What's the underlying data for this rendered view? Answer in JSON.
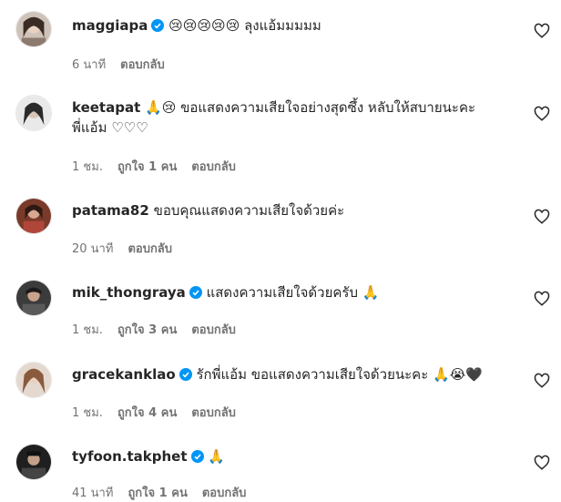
{
  "comments": [
    {
      "username": "maggiapa",
      "verified": true,
      "text": "😢😢😢😢😢 ลุงแอ้มมมมม",
      "time": "6 นาที",
      "likes": "",
      "reply": "ตอบกลับ"
    },
    {
      "username": "keetapat",
      "verified": false,
      "text": "🙏😢 ขอแสดงความเสียใจอย่างสุดซึ้ง หลับให้สบายนะคะ",
      "text2": "พี่แอ้ม ♡♡♡",
      "time": "1 ชม.",
      "likes": "ถูกใจ 1 คน",
      "reply": "ตอบกลับ"
    },
    {
      "username": "patama82",
      "verified": false,
      "text": "ขอบคุณแสดงความเสียใจด้วยค่ะ",
      "time": "20 นาที",
      "likes": "",
      "reply": "ตอบกลับ"
    },
    {
      "username": "mik_thongraya",
      "verified": true,
      "text": "แสดงความเสียใจด้วยครับ 🙏",
      "time": "1 ชม.",
      "likes": "ถูกใจ 3 คน",
      "reply": "ตอบกลับ"
    },
    {
      "username": "gracekanklao",
      "verified": true,
      "text": "รักพี่แอ้ม ขอแสดงความเสียใจด้วยนะคะ 🙏😭🖤",
      "time": "1 ชม.",
      "likes": "ถูกใจ 4 คน",
      "reply": "ตอบกลับ"
    },
    {
      "username": "tyfoon.takphet",
      "verified": true,
      "text": "🙏",
      "time": "41 นาที",
      "likes": "ถูกใจ 1 คน",
      "reply": "ตอบกลับ"
    }
  ],
  "colors": {
    "verified": "#0095f6",
    "meta": "#737373"
  },
  "icons": {
    "like": "heart-outline-icon",
    "verified": "verified-badge-icon"
  }
}
